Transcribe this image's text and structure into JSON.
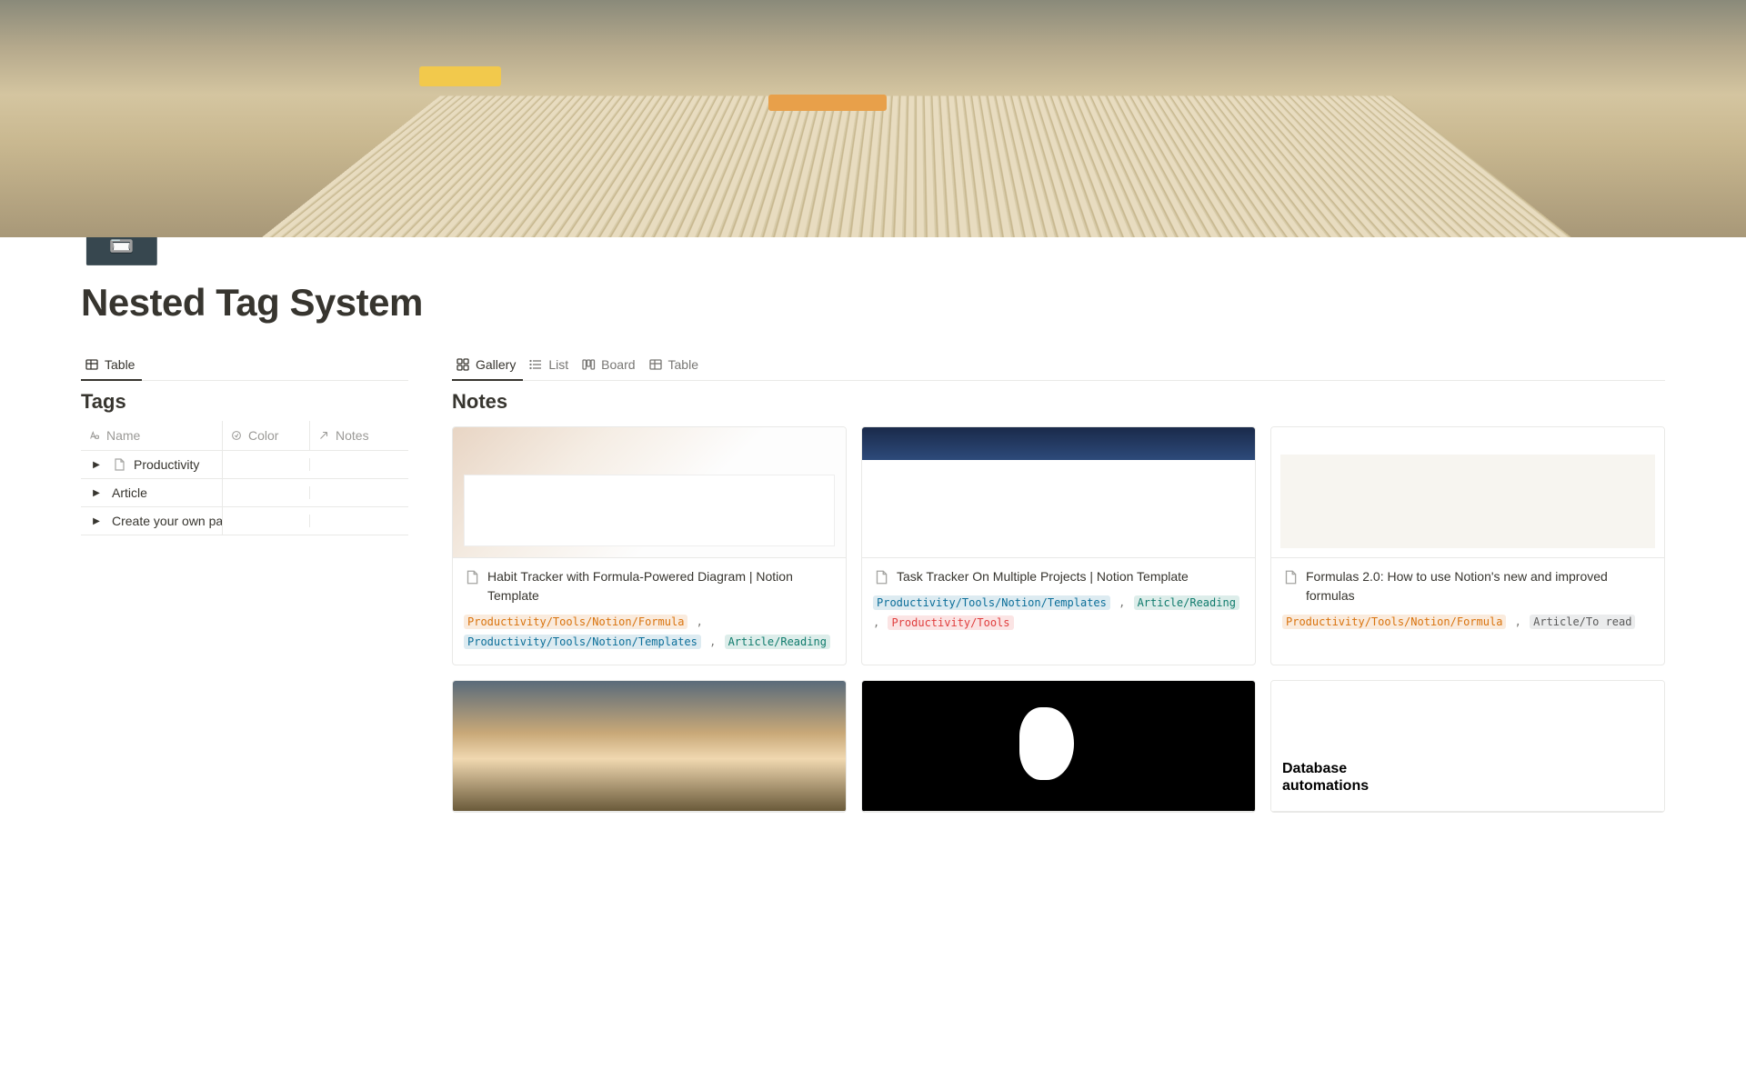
{
  "page": {
    "icon": "🗃️",
    "title": "Nested Tag System"
  },
  "left": {
    "tabs": [
      {
        "label": "Table",
        "active": true
      }
    ],
    "db_title": "Tags",
    "columns": {
      "name": "Name",
      "color": "Color",
      "notes": "Notes"
    },
    "rows": [
      {
        "name": "Productivity",
        "has_icon": true
      },
      {
        "name": "Article",
        "has_icon": false
      },
      {
        "name": "Create your own path",
        "has_icon": false
      }
    ]
  },
  "right": {
    "tabs": [
      {
        "label": "Gallery",
        "active": true
      },
      {
        "label": "List",
        "active": false
      },
      {
        "label": "Board",
        "active": false
      },
      {
        "label": "Table",
        "active": false
      }
    ],
    "db_title": "Notes",
    "cards": [
      {
        "title": "Habit Tracker with Formula-Powered Diagram | Notion Template",
        "cover": "cov-habit",
        "tags": [
          {
            "text": "Productivity/Tools/Notion/Formula",
            "color": "c-orange"
          },
          {
            "text": "Productivity/Tools/Notion/Templates",
            "color": "c-blue"
          },
          {
            "text": "Article/Reading",
            "color": "c-green"
          }
        ]
      },
      {
        "title": "Task Tracker On Multiple Projects | Notion Template",
        "cover": "cov-task",
        "tags": [
          {
            "text": "Productivity/Tools/Notion/Templates",
            "color": "c-blue"
          },
          {
            "text": "Article/Reading",
            "color": "c-green"
          },
          {
            "text": "Productivity/Tools",
            "color": "c-red"
          }
        ]
      },
      {
        "title": "Formulas 2.0: How to use Notion's new and improved formulas",
        "cover": "cov-formula",
        "tags": [
          {
            "text": "Productivity/Tools/Notion/Formula",
            "color": "c-orange"
          },
          {
            "text": "Article/To read",
            "color": "c-gray"
          }
        ]
      },
      {
        "title": "",
        "cover": "cov-sunset",
        "tags": []
      },
      {
        "title": "",
        "cover": "cov-blob",
        "tags": []
      },
      {
        "title": "",
        "cover": "cov-dbauto",
        "tags": [],
        "overlay": "Database\nautomations"
      }
    ]
  }
}
